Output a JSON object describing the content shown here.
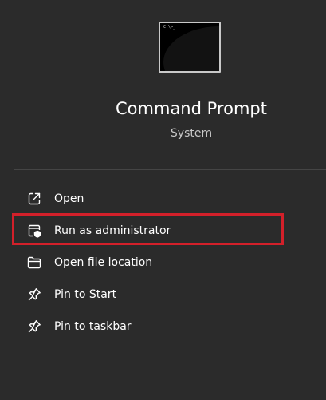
{
  "app": {
    "name": "Command Prompt",
    "type": "System",
    "icon": "command-prompt-icon",
    "icon_prompt_text": "C:\\>_"
  },
  "menu": {
    "items": [
      {
        "label": "Open",
        "icon": "open-external-icon"
      },
      {
        "label": "Run as administrator",
        "icon": "run-as-admin-shield-icon"
      },
      {
        "label": "Open file location",
        "icon": "folder-icon"
      },
      {
        "label": "Pin to Start",
        "icon": "pin-icon"
      },
      {
        "label": "Pin to taskbar",
        "icon": "pin-icon"
      }
    ]
  },
  "colors": {
    "background": "#2b2b2b",
    "text": "#ffffff",
    "secondary_text": "#c8c8c8",
    "divider": "#454545",
    "highlight_box": "#d3202a"
  }
}
